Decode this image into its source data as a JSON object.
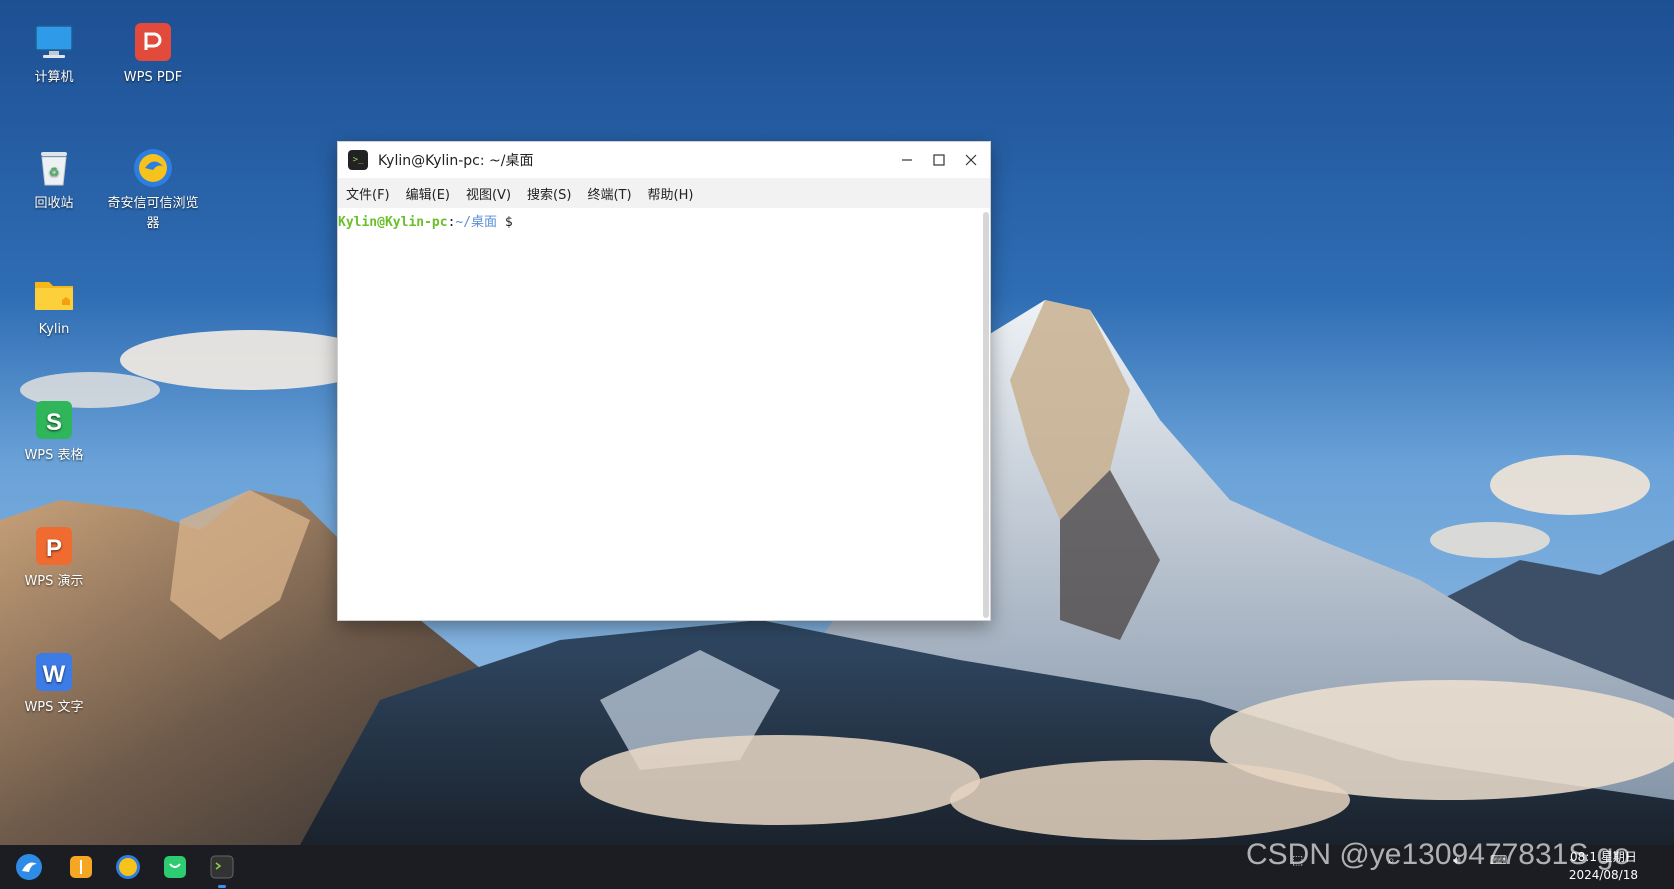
{
  "desktop": {
    "icons": [
      {
        "label": "计算机"
      },
      {
        "label": "WPS PDF"
      },
      {
        "label": "回收站"
      },
      {
        "label": "奇安信可信浏览器"
      },
      {
        "label": "Kylin"
      },
      {
        "label": "WPS 表格"
      },
      {
        "label": "WPS 演示"
      },
      {
        "label": "WPS 文字"
      }
    ]
  },
  "terminal": {
    "title": "Kylin@Kylin-pc: ~/桌面",
    "menu": [
      "文件(F)",
      "编辑(E)",
      "视图(V)",
      "搜索(S)",
      "终端(T)",
      "帮助(H)"
    ],
    "prompt_user": "Kylin@Kylin-pc",
    "prompt_sep": ":",
    "prompt_path": "~/桌面",
    "prompt_symbol": "$",
    "controls": {
      "minimize": "minimize-icon",
      "maximize": "maximize-icon",
      "close": "close-icon"
    }
  },
  "taskbar": {
    "clock_time": "08:1 星期日",
    "clock_date": "2024/08/18"
  },
  "watermark": "CSDN @ye1309477831S go",
  "colors": {
    "prompt_user": "#6bbf2b",
    "prompt_path": "#5a8ed6",
    "taskbar": "#1b1d22"
  }
}
